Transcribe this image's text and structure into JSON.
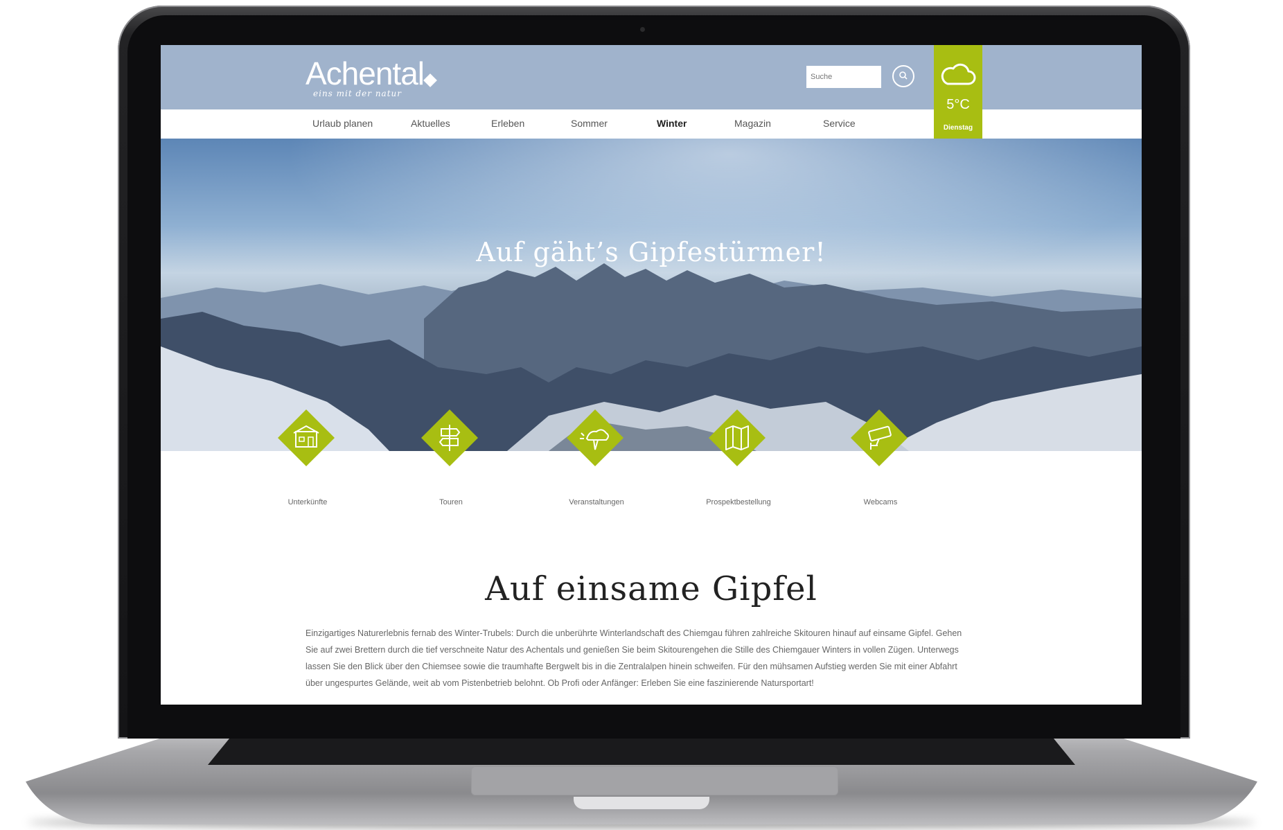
{
  "site": {
    "logo": "Achental",
    "tagline": "eins mit der natur",
    "search_placeholder": "Suche"
  },
  "nav": {
    "items": [
      "Urlaub planen",
      "Aktuelles",
      "Erleben",
      "Sommer",
      "Winter",
      "Magazin",
      "Service"
    ],
    "active": "Winter"
  },
  "weather": {
    "icon": "cloud-icon",
    "temperature": "5°C",
    "day": "Dienstag"
  },
  "hero": {
    "title": "Auf gäht’s Gipfestürmer!"
  },
  "features": [
    {
      "label": "Unterkünfte",
      "icon": "house-icon"
    },
    {
      "label": "Touren",
      "icon": "signpost-icon"
    },
    {
      "label": "Veranstaltungen",
      "icon": "event-icon"
    },
    {
      "label": "Prospektbestellung",
      "icon": "brochure-icon"
    },
    {
      "label": "Webcams",
      "icon": "camera-icon"
    }
  ],
  "content": {
    "title": "Auf einsame Gipfel",
    "text": "Einzigartiges Naturerlebnis fernab des Winter-Trubels: Durch die unberührte Winterlandschaft des Chiemgau führen zahlreiche Skitouren hinauf auf einsame Gipfel. Gehen Sie auf zwei Brettern durch die tief verschneite Natur des Achentals und genießen Sie beim Skitourengehen die Stille des Chiemgauer Winters in vollen Zügen. Unterwegs lassen Sie den Blick über den Chiemsee sowie die traumhafte Bergwelt bis in die Zentralalpen hinein schweifen. Für den mühsamen Aufstieg werden Sie mit einer Abfahrt über ungespurtes Gelände, weit ab vom Pistenbetrieb belohnt. Ob Profi oder Anfänger: Erleben Sie eine faszinierende Natursportart!"
  },
  "colors": {
    "accent": "#a8be12",
    "header": "#a0b3cc"
  }
}
